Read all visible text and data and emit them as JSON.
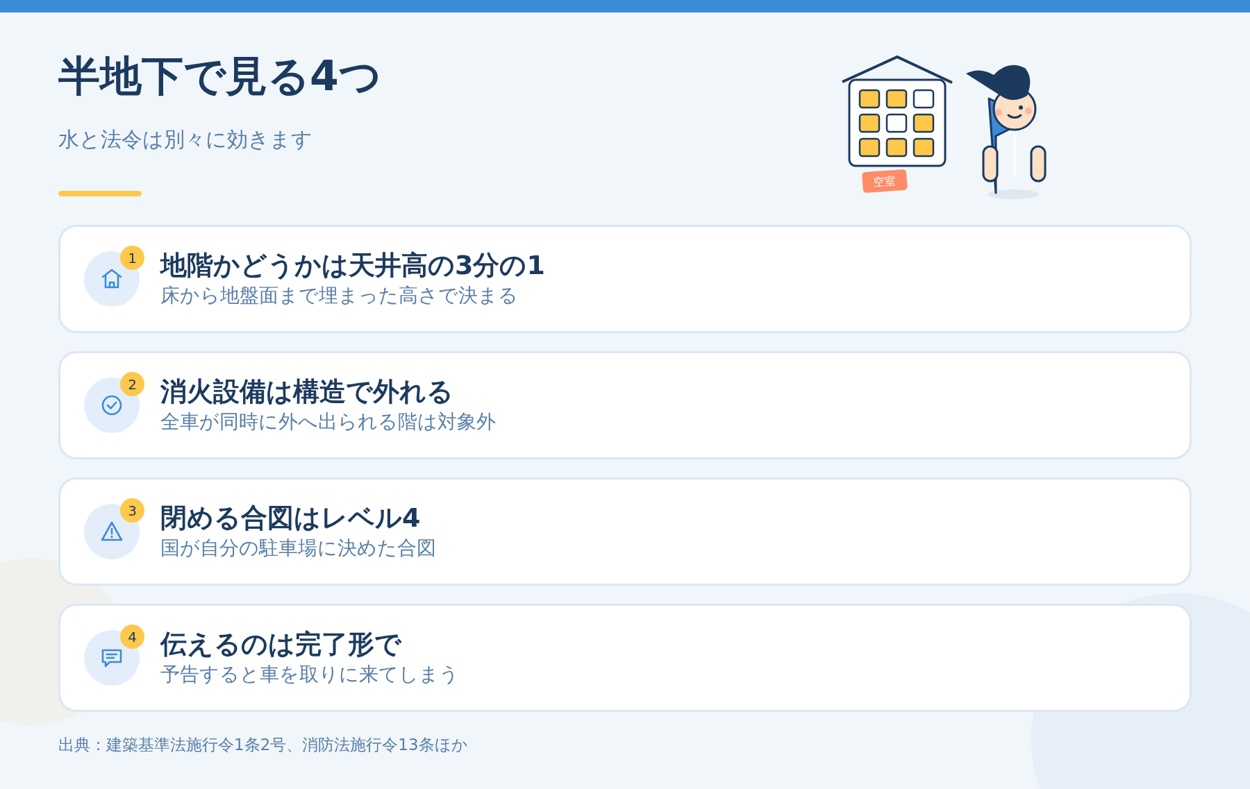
{
  "header": {
    "title": "半地下で見る4つ",
    "subtitle": "水と法令は別々に効きます"
  },
  "illustration": {
    "tag": "空室"
  },
  "items": [
    {
      "number": "1",
      "title": "地階かどうかは天井高の3分の1",
      "text": "床から地盤面まで埋まった高さで決まる"
    },
    {
      "number": "2",
      "title": "消火設備は構造で外れる",
      "text": "全車が同時に外へ出られる階は対象外"
    },
    {
      "number": "3",
      "title": "閉める合図はレベル4",
      "text": "国が自分の駐車場に決めた合図"
    },
    {
      "number": "4",
      "title": "伝えるのは完了形で",
      "text": "予告すると車を取りに来てしまう"
    }
  ],
  "footer": "出典：建築基準法施行令1条2号、消防法施行令13条ほか"
}
